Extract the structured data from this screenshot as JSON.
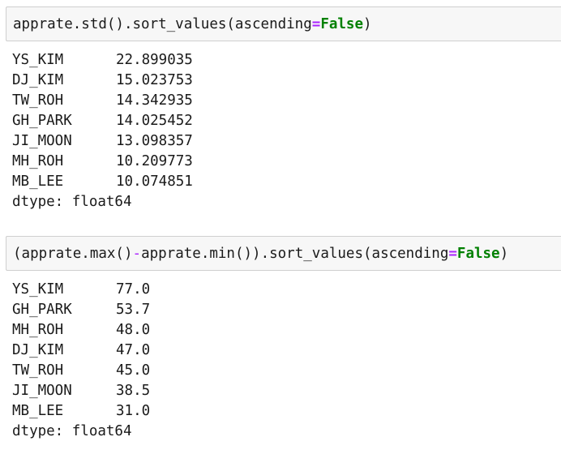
{
  "cell1": {
    "code_prefix": "apprate.std().sort_values(ascending",
    "code_eq": "=",
    "code_kw": "False",
    "code_suffix": ")",
    "output": [
      {
        "name": "YS_KIM",
        "value": "22.899035"
      },
      {
        "name": "DJ_KIM",
        "value": "15.023753"
      },
      {
        "name": "TW_ROH",
        "value": "14.342935"
      },
      {
        "name": "GH_PARK",
        "value": "14.025452"
      },
      {
        "name": "JI_MOON",
        "value": "13.098357"
      },
      {
        "name": "MH_ROH",
        "value": "10.209773"
      },
      {
        "name": "MB_LEE",
        "value": "10.074851"
      }
    ],
    "dtype": "dtype: float64"
  },
  "cell2": {
    "code_part1": "(apprate.max()",
    "code_minus": "-",
    "code_part2": "apprate.min()).sort_values(ascending",
    "code_eq": "=",
    "code_kw": "False",
    "code_suffix": ")",
    "output": [
      {
        "name": "YS_KIM",
        "value": "77.0"
      },
      {
        "name": "GH_PARK",
        "value": "53.7"
      },
      {
        "name": "MH_ROH",
        "value": "48.0"
      },
      {
        "name": "DJ_KIM",
        "value": "47.0"
      },
      {
        "name": "TW_ROH",
        "value": "45.0"
      },
      {
        "name": "JI_MOON",
        "value": "38.5"
      },
      {
        "name": "MB_LEE",
        "value": "31.0"
      }
    ],
    "dtype": "dtype: float64"
  }
}
